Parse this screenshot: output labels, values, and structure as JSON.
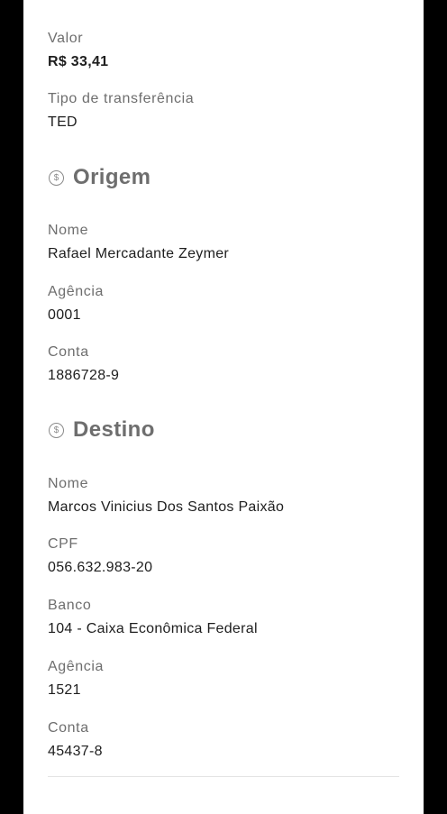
{
  "transfer": {
    "valor_label": "Valor",
    "valor_value": "R$ 33,41",
    "tipo_label": "Tipo de transferência",
    "tipo_value": "TED"
  },
  "origem": {
    "title": "Origem",
    "icon": "dollar-circle-icon",
    "icon_glyph": "$",
    "nome_label": "Nome",
    "nome_value": "Rafael Mercadante Zeymer",
    "agencia_label": "Agência",
    "agencia_value": "0001",
    "conta_label": "Conta",
    "conta_value": "1886728-9"
  },
  "destino": {
    "title": "Destino",
    "icon": "dollar-circle-icon",
    "icon_glyph": "$",
    "nome_label": "Nome",
    "nome_value": "Marcos Vinicius Dos Santos Paixão",
    "cpf_label": "CPF",
    "cpf_value": "056.632.983-20",
    "banco_label": "Banco",
    "banco_value": "104 - Caixa Econômica Federal",
    "agencia_label": "Agência",
    "agencia_value": "1521",
    "conta_label": "Conta",
    "conta_value": "45437-8"
  },
  "colors": {
    "background": "#ffffff",
    "frame": "#000000",
    "label": "#6e6e6e",
    "value": "#1e1e1e",
    "divider": "#e3e3e3"
  }
}
